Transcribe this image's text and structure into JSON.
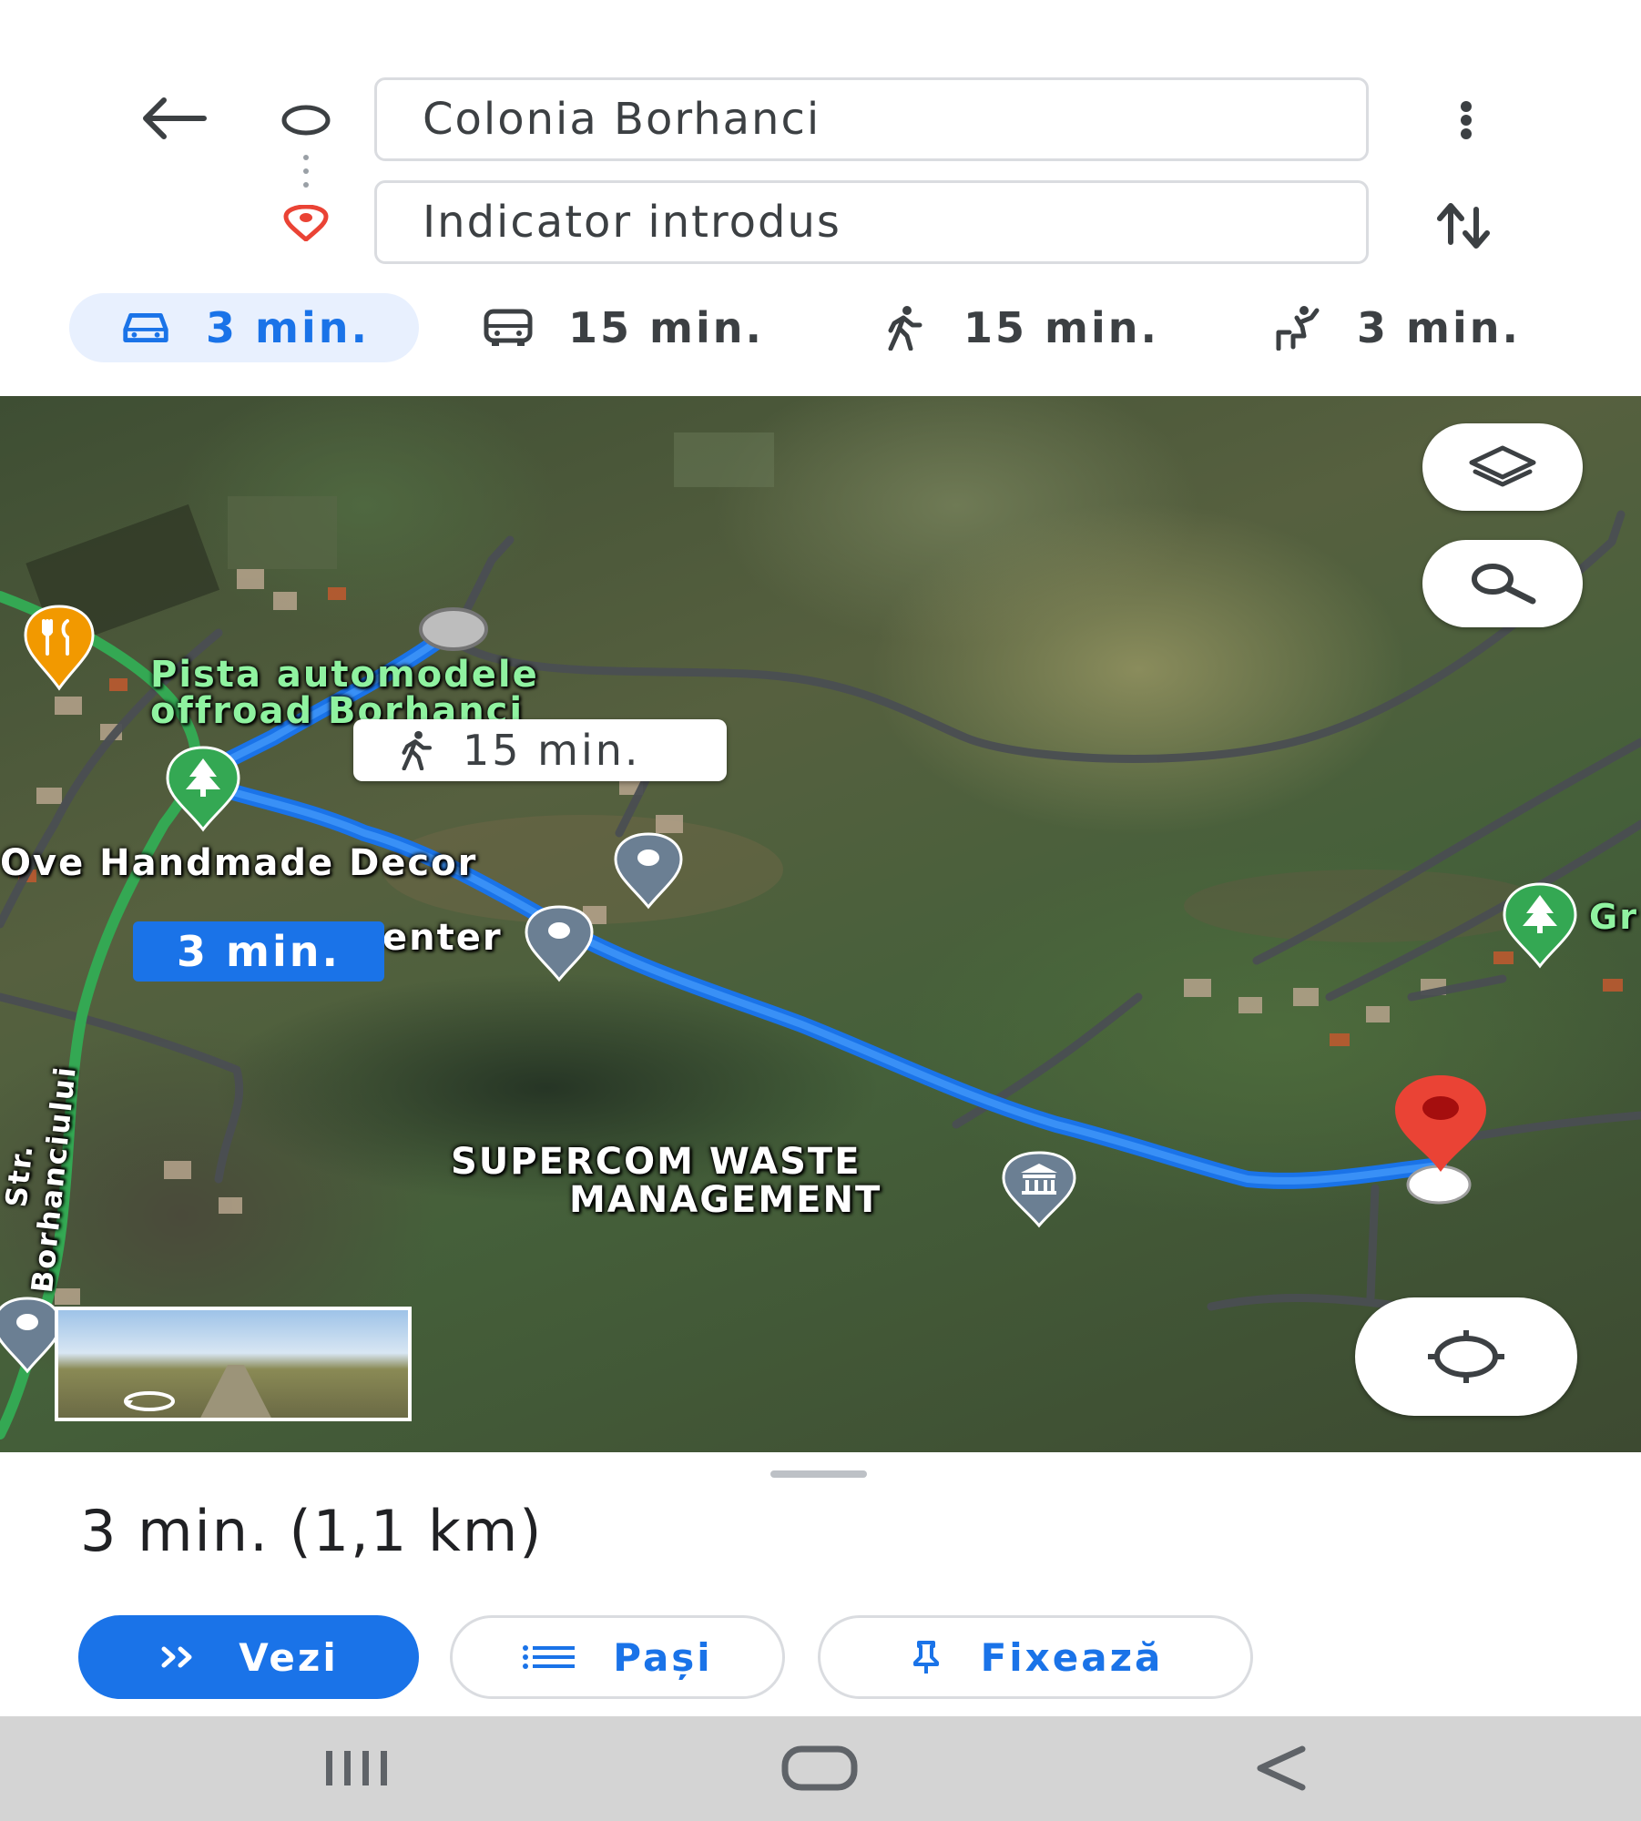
{
  "header": {
    "origin_value": "Colonia Borhanci",
    "destination_value": "Indicator introdus"
  },
  "modes": [
    {
      "name": "car",
      "label": "3 min.",
      "selected": true
    },
    {
      "name": "transit",
      "label": "15 min."
    },
    {
      "name": "walk",
      "label": "15 min."
    },
    {
      "name": "ride-hailing",
      "label": "3 min."
    }
  ],
  "map": {
    "labels": {
      "pista": "Pista automodele",
      "offroad": "offroad Borhanci",
      "love": "Ove Handmade Decor",
      "center": "enter",
      "supercom1": "SUPERCOM WASTE",
      "supercom2": "MANAGEMENT",
      "street": "Str. Borhanciului",
      "gr": "Gr"
    },
    "walk_callout": "15 min.",
    "car_callout": "3 min.",
    "route_color": "#1a73e8"
  },
  "sheet": {
    "summary": "3 min. (1,1 km)",
    "buttons": {
      "start": "Vezi",
      "steps": "Pași",
      "pin": "Fixează"
    }
  },
  "colors": {
    "accent": "#1a73e8",
    "destination": "#ea4335",
    "park": "#34a853",
    "restaurant": "#f29900"
  }
}
